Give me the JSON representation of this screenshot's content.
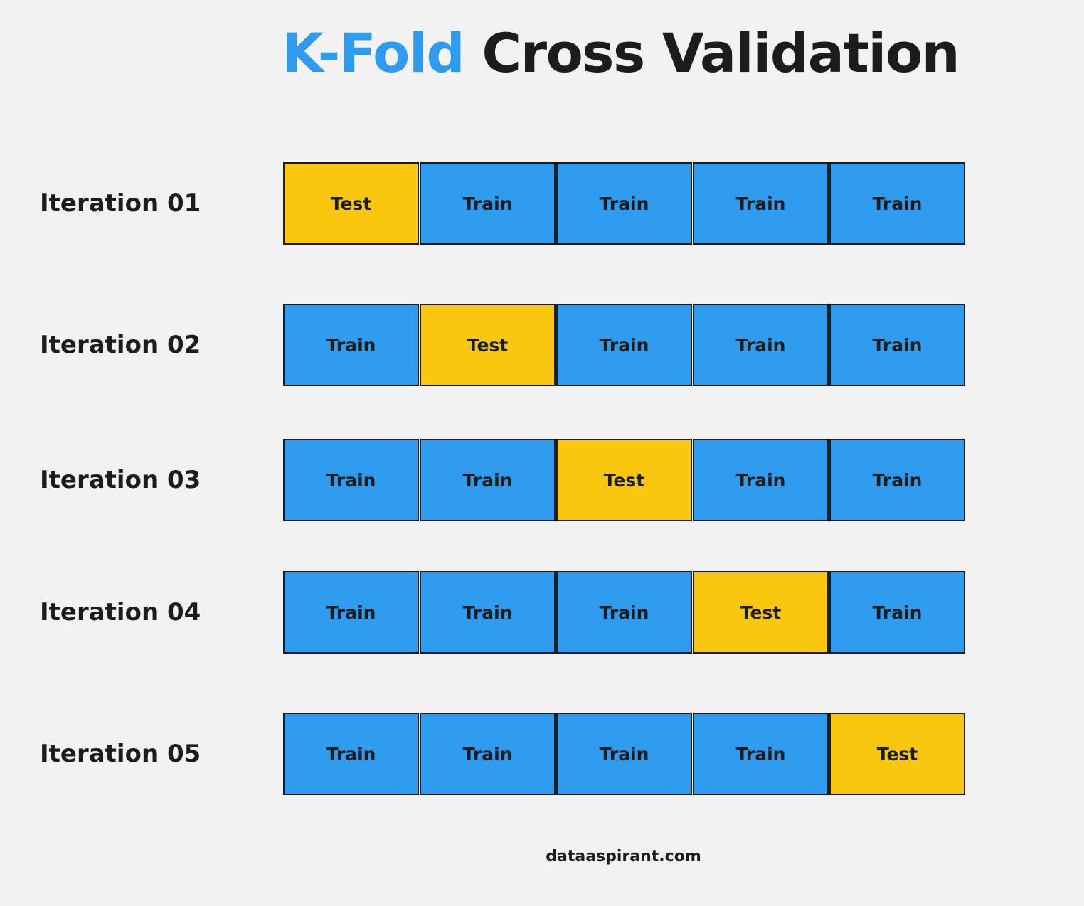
{
  "title": {
    "highlight": "K-Fold",
    "rest": "Cross Validation",
    "highlight_color": "#2e9bef"
  },
  "colors": {
    "train": "#2e9bef",
    "test": "#f9c710",
    "background": "#f2f2f2",
    "text": "#1c1c1c"
  },
  "iterations": [
    {
      "label": "Iteration 01",
      "folds": [
        "Test",
        "Train",
        "Train",
        "Train",
        "Train"
      ]
    },
    {
      "label": "Iteration 02",
      "folds": [
        "Train",
        "Test",
        "Train",
        "Train",
        "Train"
      ]
    },
    {
      "label": "Iteration 03",
      "folds": [
        "Train",
        "Train",
        "Test",
        "Train",
        "Train"
      ]
    },
    {
      "label": "Iteration 04",
      "folds": [
        "Train",
        "Train",
        "Train",
        "Test",
        "Train"
      ]
    },
    {
      "label": "Iteration 05",
      "folds": [
        "Train",
        "Train",
        "Train",
        "Train",
        "Test"
      ]
    }
  ],
  "footer": "dataaspirant.com"
}
